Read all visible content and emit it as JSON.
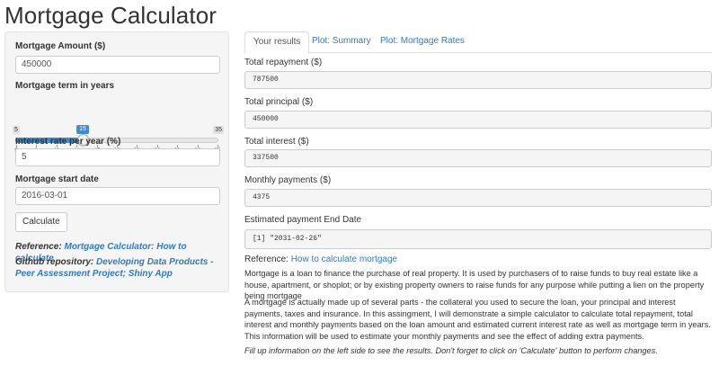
{
  "title": "Mortgage Calculator",
  "sidebar": {
    "amount_label": "Mortgage Amount ($)",
    "amount_value": "450000",
    "term_label": "Mortgage term in years",
    "term_slider": {
      "min": "5",
      "max": "35",
      "value": "15",
      "value_fraction": 0.3333,
      "ticks": [
        "5",
        "8",
        "11",
        "14",
        "17",
        "20",
        "23",
        "26",
        "29",
        "32",
        "35"
      ]
    },
    "rate_label": "Interest rate per year (%)",
    "rate_value": "5",
    "start_label": "Mortgage start date",
    "start_value": "2016-03-01",
    "calculate_label": "Calculate",
    "reference_prefix": "Reference:",
    "reference_link": "Mortgage Calculator: How to calculate",
    "github_prefix": "Github repository:",
    "github_link": "Developing Data Products - Peer Assessment Project; Shiny App"
  },
  "tabs": [
    {
      "label": "Your results",
      "active": true
    },
    {
      "label": "Plot: Summary",
      "active": false
    },
    {
      "label": "Plot: Mortgage Rates",
      "active": false
    }
  ],
  "results": {
    "total_repayment_label": "Total repayment ($)",
    "total_repayment_value": "787500",
    "total_principal_label": "Total principal ($)",
    "total_principal_value": "450000",
    "total_interest_label": "Total interest ($)",
    "total_interest_value": "337500",
    "monthly_label": "Monthly payments ($)",
    "monthly_value": "4375",
    "end_date_label": "Estimated payment End Date",
    "end_date_value": "[1] \"2031-02-26\""
  },
  "reference": {
    "prefix": "Reference:",
    "link": "How to calculate mortgage"
  },
  "paragraphs": {
    "p1": "Mortgage is a loan to finance the purchase of real property. It is used by purchasers of to raise funds to buy real estate like a house, apartment, or shoplot; or by existing property owners to raise funds for any purpose while putting a lien on the property being mortgage",
    "p2": "A mortgage is actually made up of several parts - the collateral you used to secure the loan, your principal and interest payments, taxes and insurance. In this assingment, I will demonstrate a simple calculator to calculate total repayment, total interest and monthly payments based on the loan amount and estimated current interest rate as well as mortgage term in years. This information will be used to estimate your monthly payments and see the effect of adding extra payments.",
    "p3": "Fill up information on the left side to see the results. Don't forget to click on 'Calculate' button to perform changes."
  },
  "colors": {
    "accent": "#428bca",
    "link": "#337ab7",
    "well": "#f5f5f5"
  }
}
